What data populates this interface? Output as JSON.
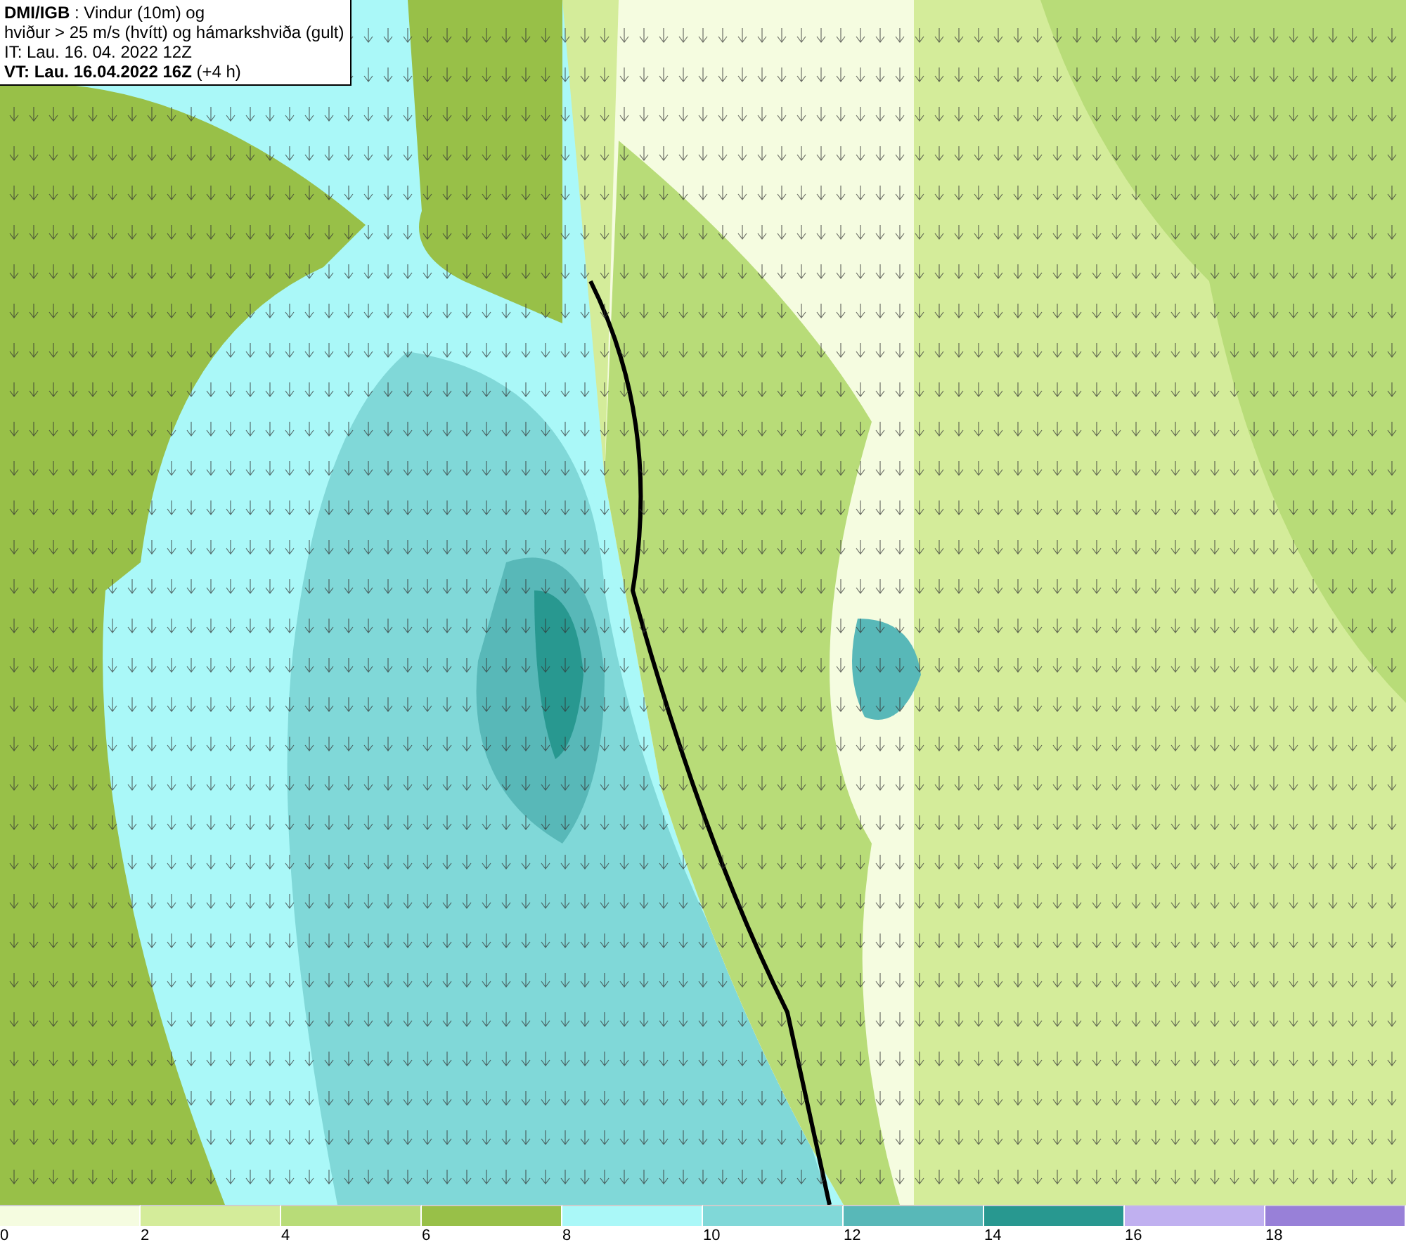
{
  "info_box": {
    "lines": [
      "**DMI/IGB** : Vindur (10m) og",
      "hviður > 25 m/s (hvítt) og hámarkshviða (gult)",
      "IT: Lau. 16. 04. 2022 12Z",
      "**VT: Lau. 16.04.2022 16Z** (+4 h)"
    ]
  },
  "legend": [
    {
      "label": "0",
      "color": "#f5fce0"
    },
    {
      "label": "2",
      "color": "#d4ec9a"
    },
    {
      "label": "4",
      "color": "#b8dc78"
    },
    {
      "label": "6",
      "color": "#98c048"
    },
    {
      "label": "8",
      "color": "#aaf8f8"
    },
    {
      "label": "10",
      "color": "#80d8d8"
    },
    {
      "label": "12",
      "color": "#58b8b8"
    },
    {
      "label": "14",
      "color": "#289890"
    },
    {
      "label": "16",
      "color": "#c0b0f0"
    },
    {
      "label": "18",
      "color": "#9880d8"
    }
  ]
}
